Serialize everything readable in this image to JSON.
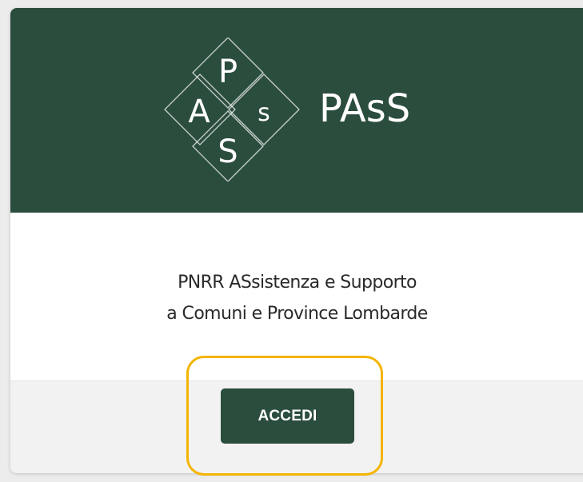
{
  "brand": {
    "logo_letters": [
      "P",
      "A",
      "s",
      "S"
    ],
    "wordmark": "PAsS"
  },
  "card": {
    "description_line1": "PNRR ASsistenza e Supporto",
    "description_line2": "a Comuni e Province Lombarde",
    "button_label": "ACCEDI"
  },
  "colors": {
    "header_bg": "#2b4d3e",
    "button_bg": "#2b4d3e",
    "highlight": "#f4b400"
  }
}
